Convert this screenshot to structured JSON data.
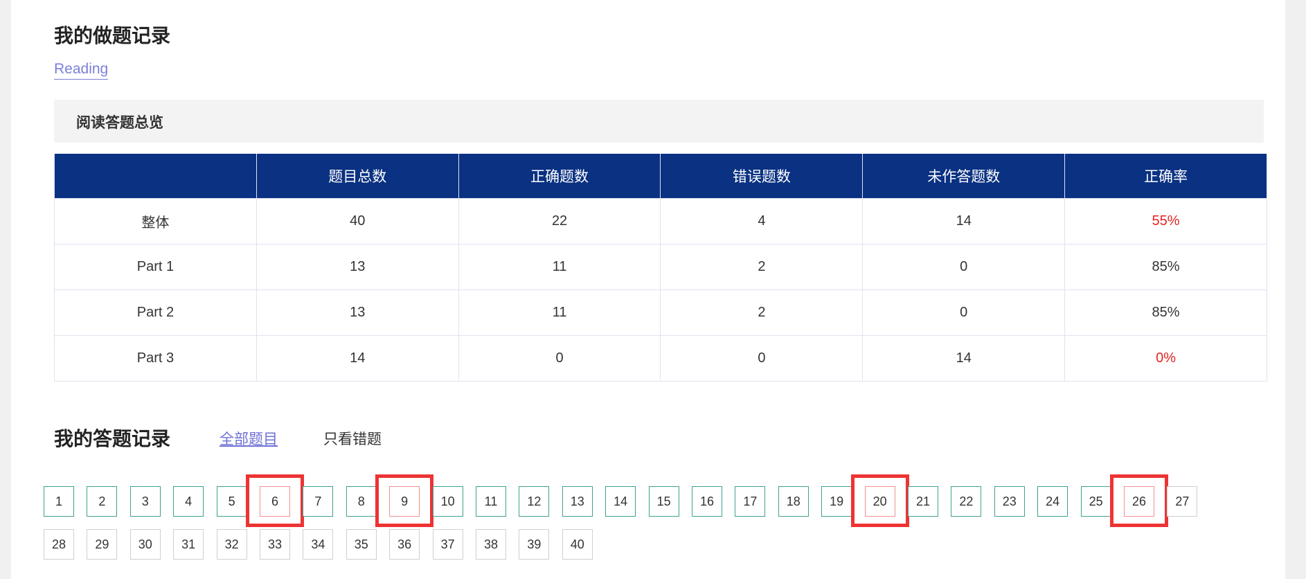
{
  "page_title": "我的做题记录",
  "tab": "Reading",
  "overview_title": "阅读答题总览",
  "table": {
    "headers": [
      "",
      "题目总数",
      "正确题数",
      "错误题数",
      "未作答题数",
      "正确率"
    ],
    "rows": [
      {
        "label": "整体",
        "total": "40",
        "correct": "22",
        "wrong": "4",
        "unanswered": "14",
        "rate": "55%",
        "rate_red": true
      },
      {
        "label": "Part 1",
        "total": "13",
        "correct": "11",
        "wrong": "2",
        "unanswered": "0",
        "rate": "85%",
        "rate_red": false
      },
      {
        "label": "Part 2",
        "total": "13",
        "correct": "11",
        "wrong": "2",
        "unanswered": "0",
        "rate": "85%",
        "rate_red": false
      },
      {
        "label": "Part 3",
        "total": "14",
        "correct": "0",
        "wrong": "0",
        "unanswered": "14",
        "rate": "0%",
        "rate_red": true
      }
    ]
  },
  "record_title": "我的答题记录",
  "filters": {
    "all": "全部题目",
    "wrong_only": "只看错题"
  },
  "questions": [
    {
      "n": "1",
      "status": "correct"
    },
    {
      "n": "2",
      "status": "correct"
    },
    {
      "n": "3",
      "status": "correct"
    },
    {
      "n": "4",
      "status": "correct"
    },
    {
      "n": "5",
      "status": "correct"
    },
    {
      "n": "6",
      "status": "wrong"
    },
    {
      "n": "7",
      "status": "correct"
    },
    {
      "n": "8",
      "status": "correct"
    },
    {
      "n": "9",
      "status": "wrong"
    },
    {
      "n": "10",
      "status": "correct"
    },
    {
      "n": "11",
      "status": "correct"
    },
    {
      "n": "12",
      "status": "correct"
    },
    {
      "n": "13",
      "status": "correct"
    },
    {
      "n": "14",
      "status": "correct"
    },
    {
      "n": "15",
      "status": "correct"
    },
    {
      "n": "16",
      "status": "correct"
    },
    {
      "n": "17",
      "status": "correct"
    },
    {
      "n": "18",
      "status": "correct"
    },
    {
      "n": "19",
      "status": "correct"
    },
    {
      "n": "20",
      "status": "wrong"
    },
    {
      "n": "21",
      "status": "correct"
    },
    {
      "n": "22",
      "status": "correct"
    },
    {
      "n": "23",
      "status": "correct"
    },
    {
      "n": "24",
      "status": "correct"
    },
    {
      "n": "25",
      "status": "correct"
    },
    {
      "n": "26",
      "status": "wrong"
    },
    {
      "n": "27",
      "status": "unanswered"
    },
    {
      "n": "28",
      "status": "unanswered"
    },
    {
      "n": "29",
      "status": "unanswered"
    },
    {
      "n": "30",
      "status": "unanswered"
    },
    {
      "n": "31",
      "status": "unanswered"
    },
    {
      "n": "32",
      "status": "unanswered"
    },
    {
      "n": "33",
      "status": "unanswered"
    },
    {
      "n": "34",
      "status": "unanswered"
    },
    {
      "n": "35",
      "status": "unanswered"
    },
    {
      "n": "36",
      "status": "unanswered"
    },
    {
      "n": "37",
      "status": "unanswered"
    },
    {
      "n": "38",
      "status": "unanswered"
    },
    {
      "n": "39",
      "status": "unanswered"
    },
    {
      "n": "40",
      "status": "unanswered"
    }
  ],
  "colors": {
    "header_bg": "#0a3182",
    "correct_border": "#3fa08f",
    "wrong_border": "#f09090",
    "highlight": "#ee3333",
    "link": "#6c6fd6"
  }
}
